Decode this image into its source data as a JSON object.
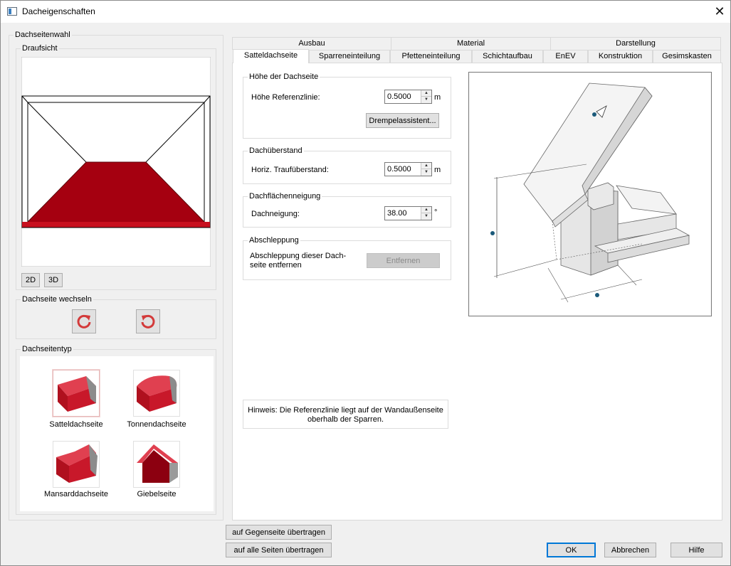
{
  "window": {
    "title": "Dacheigenschaften",
    "close": "✕"
  },
  "left": {
    "dachseitenwahl_label": "Dachseitenwahl",
    "draufsicht_label": "Draufsicht",
    "btn_2d": "2D",
    "btn_3d": "3D",
    "wechseln_label": "Dachseite wechseln",
    "rotate_cw_icon": "rotate-clockwise-icon",
    "rotate_ccw_icon": "rotate-counterclockwise-icon",
    "typ_label": "Dachseitentyp",
    "types": [
      {
        "label": "Satteldachseite",
        "selected": true
      },
      {
        "label": "Tonnendachseite",
        "selected": false
      },
      {
        "label": "Mansarddachseite",
        "selected": false
      },
      {
        "label": "Giebelseite",
        "selected": false
      }
    ]
  },
  "tabs": {
    "row1": [
      "Ausbau",
      "Material",
      "Darstellung"
    ],
    "row2": [
      "Satteldachseite",
      "Sparreneinteilung",
      "Pfetteneinteilung",
      "Schichtaufbau",
      "EnEV",
      "Konstruktion",
      "Gesimskasten"
    ],
    "active": "Satteldachseite"
  },
  "hoehe": {
    "group_label": "Höhe der Dachseite",
    "ref_label": "Höhe Referenzlinie:",
    "ref_value": "0.5000",
    "ref_unit": "m",
    "drempel_button": "Drempelassistent..."
  },
  "ueberstand": {
    "group_label": "Dachüberstand",
    "label": "Horiz. Traufüberstand:",
    "value": "0.5000",
    "unit": "m"
  },
  "neigung": {
    "group_label": "Dachflächenneigung",
    "label": "Dachneigung:",
    "value": "38.00",
    "unit": "°"
  },
  "abschleppung": {
    "group_label": "Abschleppung",
    "text_line1": "Abschleppung dieser Dach-",
    "text_line2": "seite entfernen",
    "button": "Entfernen"
  },
  "hinweis": {
    "line1": "Hinweis: Die Referenzlinie liegt auf der Wandaußenseite",
    "line2": "oberhalb der Sparren."
  },
  "colors": {
    "roof_red": "#a50010",
    "accent": "#0078d7",
    "rotate_red": "#d33a3a"
  },
  "footer": {
    "gegenseite": "auf Gegenseite übertragen",
    "alle_seiten": "auf alle Seiten übertragen",
    "ok": "OK",
    "abbrechen": "Abbrechen",
    "hilfe": "Hilfe"
  }
}
